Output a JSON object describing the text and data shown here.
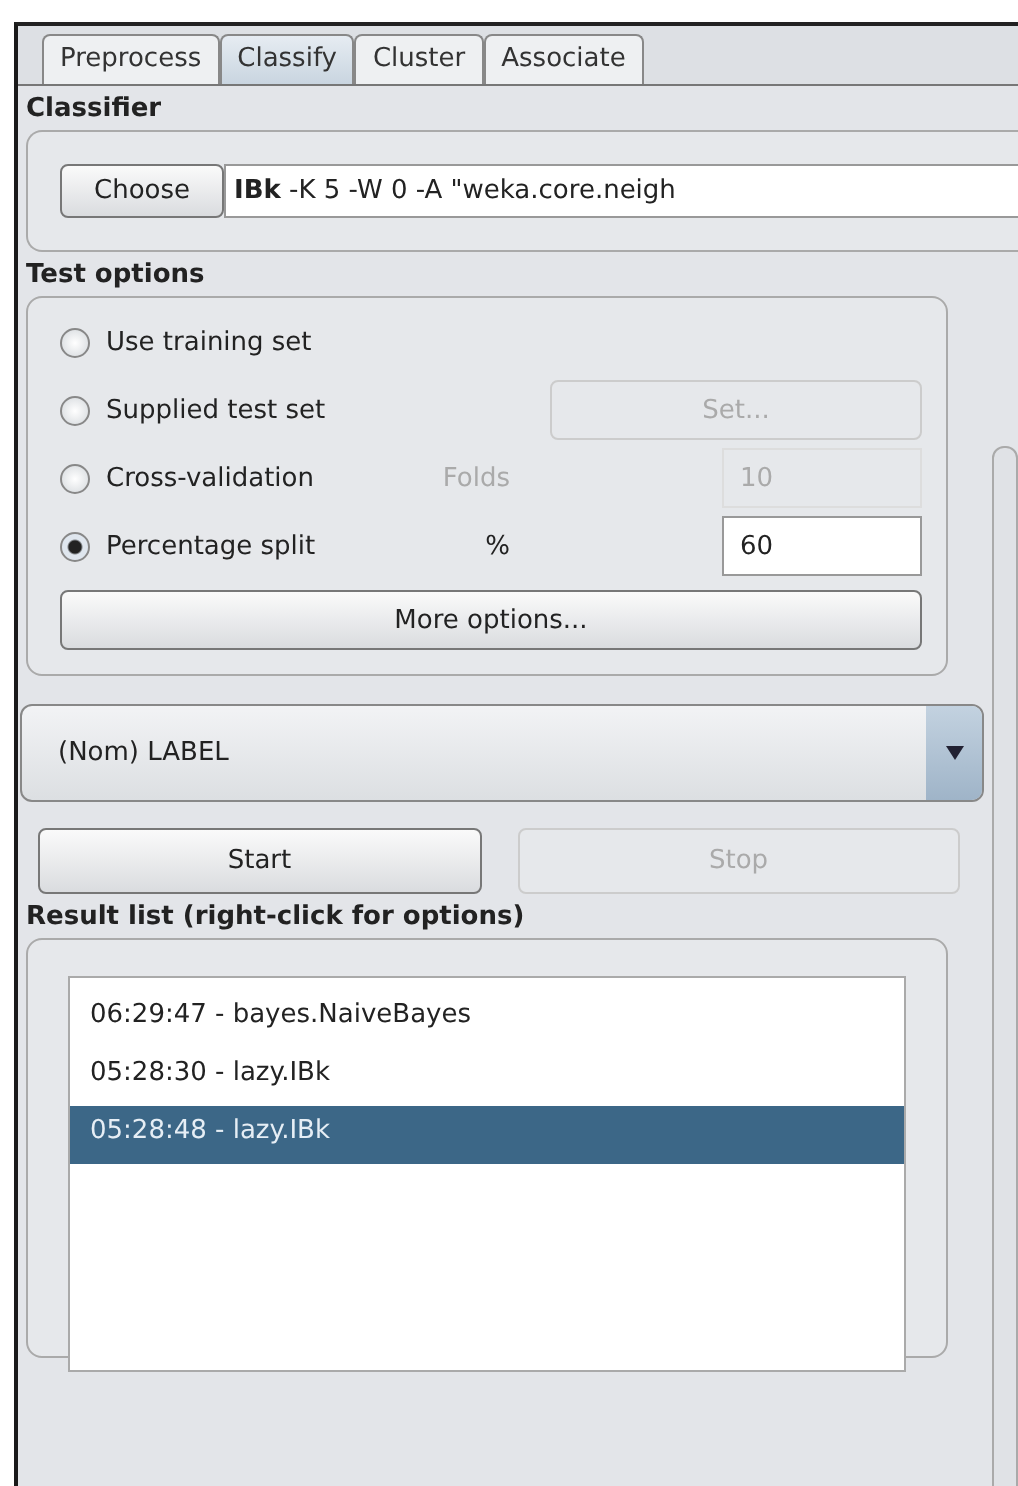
{
  "tabs": [
    {
      "label": "Preprocess",
      "selected": false
    },
    {
      "label": "Classify",
      "selected": true
    },
    {
      "label": "Cluster",
      "selected": false
    },
    {
      "label": "Associate",
      "selected": false
    }
  ],
  "classifier": {
    "title": "Classifier",
    "choose_button": "Choose",
    "value": "**IBk** -K 5 -W 0 -A \"weka.core.neigh"
  },
  "test_options": {
    "title": "Test options",
    "options": [
      {
        "label": "Use training set",
        "selected": false
      },
      {
        "label": "Supplied test set",
        "selected": false,
        "kind": "button",
        "button": {
          "label": "Set...",
          "disabled": true
        }
      },
      {
        "label": "Cross-validation",
        "selected": false,
        "kind": "field",
        "field": {
          "label": "Folds",
          "value": "10",
          "disabled": true
        }
      },
      {
        "label": "Percentage split",
        "selected": true,
        "kind": "field",
        "field": {
          "label": "%",
          "value": "60",
          "disabled": false
        }
      }
    ],
    "more_button": "More options..."
  },
  "class_dropdown": {
    "value": "(Nom) LABEL"
  },
  "start_button": {
    "label": "Start",
    "disabled": false
  },
  "stop_button": {
    "label": "Stop",
    "disabled": true
  },
  "result_list": {
    "title": "Result list (right-click for options)",
    "items": [
      {
        "label": "06:29:47 - bayes.NaiveBayes",
        "selected": false
      },
      {
        "label": "05:28:30 - lazy.IBk",
        "selected": false
      },
      {
        "label": "05:28:48 - lazy.IBk",
        "selected": true
      }
    ]
  }
}
